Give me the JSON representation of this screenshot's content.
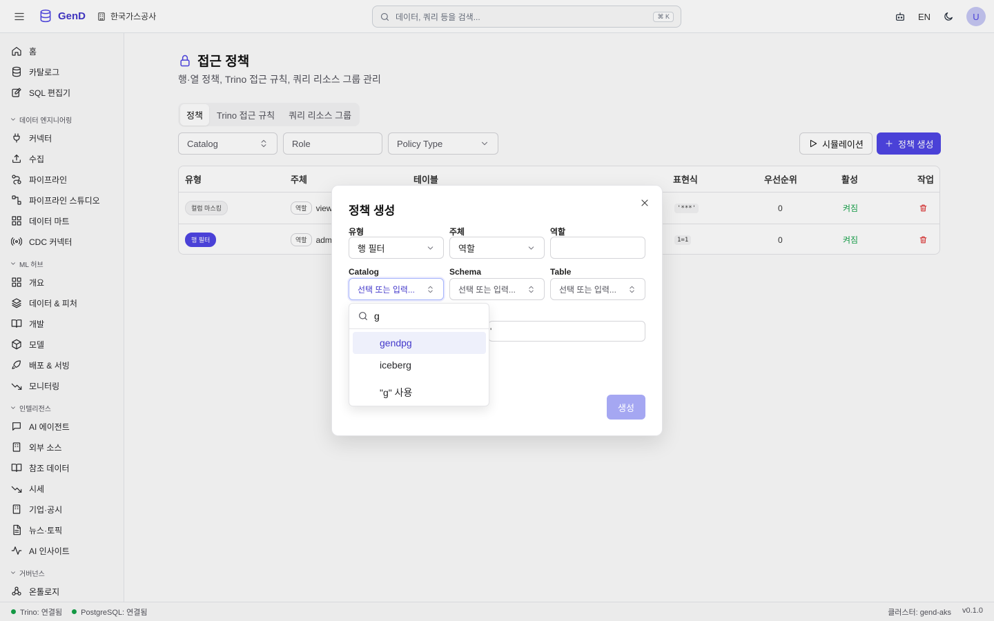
{
  "header": {
    "app_name": "GenD",
    "org_name": "한국가스공사",
    "search_placeholder": "데이터, 쿼리 등을 검색...",
    "search_shortcut": "⌘ K",
    "lang": "EN",
    "avatar_initial": "U"
  },
  "sidebar": {
    "items": [
      {
        "label": "홈",
        "icon": "home-icon"
      },
      {
        "label": "카탈로그",
        "icon": "database-icon"
      },
      {
        "label": "SQL 편집기",
        "icon": "edit-icon"
      }
    ],
    "sections": [
      {
        "label": "데이터 엔지니어링",
        "items": [
          {
            "label": "커넥터",
            "icon": "plug-icon"
          },
          {
            "label": "수집",
            "icon": "upload-icon"
          },
          {
            "label": "파이프라인",
            "icon": "pipeline-icon"
          },
          {
            "label": "파이프라인 스튜디오",
            "icon": "workflow-icon"
          },
          {
            "label": "데이터 마트",
            "icon": "grid-icon"
          },
          {
            "label": "CDC 커넥터",
            "icon": "radio-icon"
          }
        ]
      },
      {
        "label": "ML 허브",
        "items": [
          {
            "label": "개요",
            "icon": "grid-icon"
          },
          {
            "label": "데이터 & 피처",
            "icon": "layers-icon"
          },
          {
            "label": "개발",
            "icon": "book-icon"
          },
          {
            "label": "모델",
            "icon": "cube-icon"
          },
          {
            "label": "배포 & 서빙",
            "icon": "rocket-icon"
          },
          {
            "label": "모니터링",
            "icon": "trend-icon"
          }
        ]
      },
      {
        "label": "인텔리전스",
        "items": [
          {
            "label": "AI 에이전트",
            "icon": "chat-icon"
          },
          {
            "label": "외부 소스",
            "icon": "building-icon"
          },
          {
            "label": "참조 데이터",
            "icon": "book-icon"
          },
          {
            "label": "시세",
            "icon": "trend-icon"
          },
          {
            "label": "기업·공시",
            "icon": "building-icon"
          },
          {
            "label": "뉴스·토픽",
            "icon": "file-icon"
          },
          {
            "label": "AI 인사이트",
            "icon": "activity-icon"
          }
        ]
      },
      {
        "label": "거버넌스",
        "items": [
          {
            "label": "온톨로지",
            "icon": "ontology-icon"
          }
        ]
      }
    ]
  },
  "page": {
    "title": "접근 정책",
    "subtitle": "행·열 정책, Trino 접근 규칙, 쿼리 리소스 그룹 관리",
    "tabs": [
      "정책",
      "Trino 접근 규칙",
      "쿼리 리소스 그룹"
    ],
    "filters": {
      "catalog": "Catalog",
      "role": "Role",
      "policy_type": "Policy Type"
    },
    "simulate_label": "시뮬레이션",
    "create_label": "정책 생성"
  },
  "table": {
    "headers": [
      "유형",
      "주체",
      "테이블",
      "표현식",
      "우선순위",
      "활성",
      "작업"
    ],
    "rows": [
      {
        "type": "컬럼 마스킹",
        "subject_kind": "역할",
        "subject": "view",
        "expression": "'***'",
        "priority": "0",
        "active": "켜짐"
      },
      {
        "type": "행 필터",
        "subject_kind": "역할",
        "subject": "adm",
        "expression": "1=1",
        "priority": "0",
        "active": "켜짐"
      }
    ]
  },
  "modal": {
    "title": "정책 생성",
    "type_label": "유형",
    "type_value": "행 필터",
    "subject_label": "주체",
    "subject_value": "역할",
    "role_label": "역할",
    "role_value": "",
    "catalog_label": "Catalog",
    "catalog_placeholder": "선택 또는 입력...",
    "schema_label": "Schema",
    "schema_placeholder": "선택 또는 입력...",
    "table_label": "Table",
    "table_placeholder": "선택 또는 입력...",
    "expression_fragment": "'",
    "submit_label": "생성"
  },
  "dropdown": {
    "query": "g",
    "options": [
      "gendpg",
      "iceberg"
    ],
    "use_custom": "\"g\" 사용"
  },
  "footer": {
    "trino_status": "Trino: 연결됨",
    "pg_status": "PostgreSQL: 연결됨",
    "cluster": "클러스터: gend-aks",
    "version": "v0.1.0"
  },
  "colors": {
    "accent": "#4f46e5",
    "success": "#16a34a",
    "danger": "#dc2626"
  }
}
